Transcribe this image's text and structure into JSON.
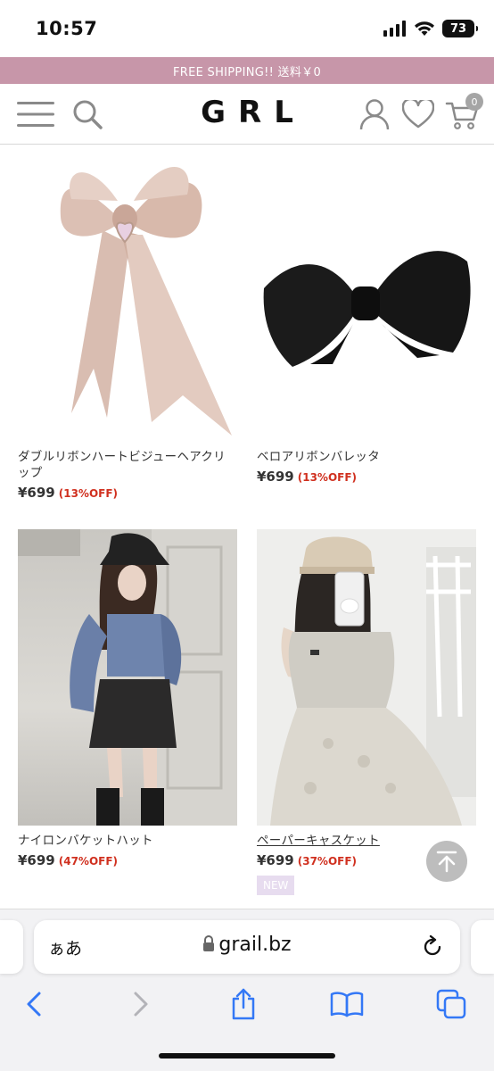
{
  "status_bar": {
    "time": "10:57",
    "battery": "73"
  },
  "banner": {
    "text": "FREE SHIPPING!! 送料￥0"
  },
  "header": {
    "logo": "GRL",
    "cart_count": "0"
  },
  "products": [
    {
      "name": "ダブルリボンハートビジューヘアクリップ",
      "price": "¥699",
      "discount": "(13%OFF)"
    },
    {
      "name": "ベロアリボンバレッタ",
      "price": "¥699",
      "discount": "(13%OFF)"
    },
    {
      "name": "ナイロンバケットハット",
      "price": "¥699",
      "discount": "(47%OFF)"
    },
    {
      "name": "ペーパーキャスケット",
      "price": "¥699",
      "discount": "(37%OFF)",
      "badge": "NEW"
    }
  ],
  "safari": {
    "aa_label": "ぁあ",
    "url": "grail.bz"
  },
  "colors": {
    "banner": "#c796a9",
    "discount": "#d0301f",
    "new_badge": "#e7dcef",
    "safari_blue": "#3478f6"
  }
}
